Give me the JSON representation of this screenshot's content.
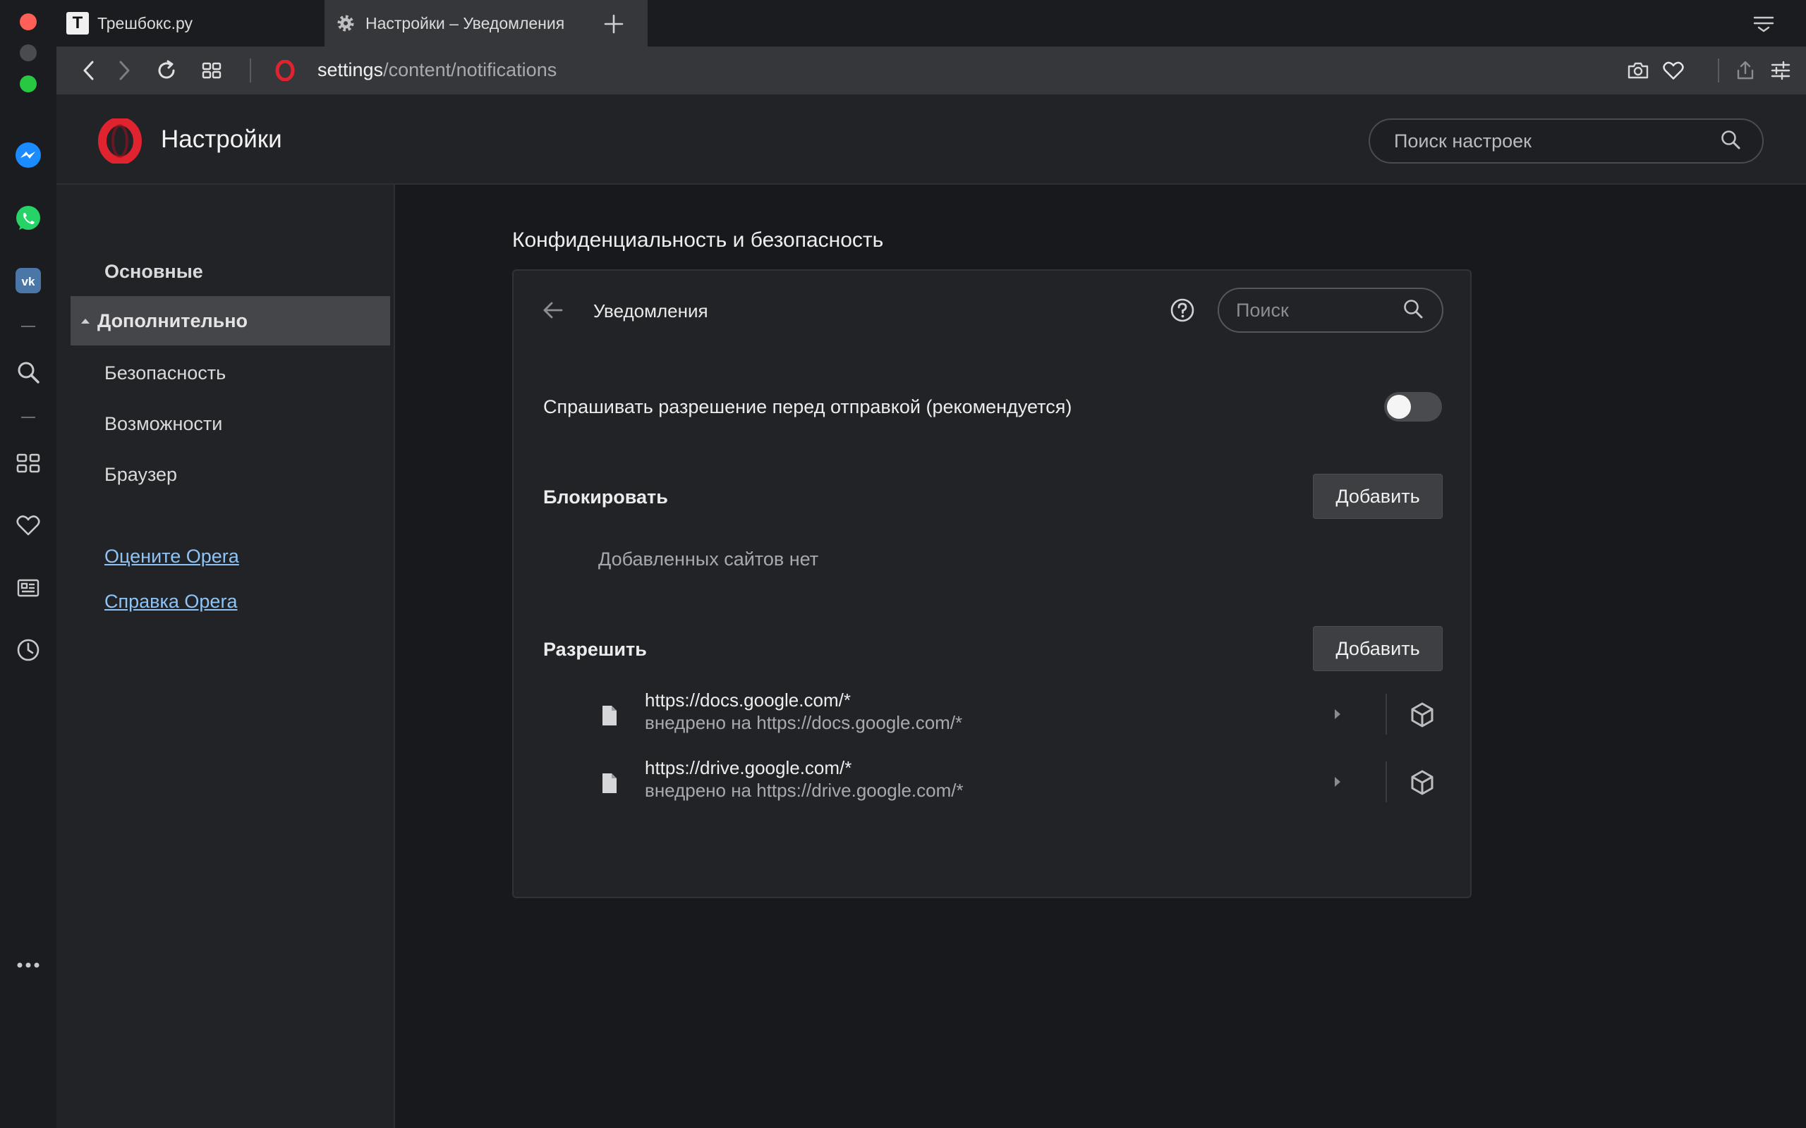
{
  "tabs": [
    {
      "title": "Трешбокс.ру",
      "favicon_letter": "T",
      "active": false
    },
    {
      "title": "Настройки – Уведомления",
      "active": true
    }
  ],
  "address": {
    "host": "settings",
    "path": "/content/notifications"
  },
  "header": {
    "title": "Настройки",
    "search_placeholder": "Поиск настроек"
  },
  "nav": {
    "basic": "Основные",
    "advanced": "Дополнительно",
    "security": "Безопасность",
    "features": "Возможности",
    "browser": "Браузер",
    "rate_link": "Оцените Opera",
    "help_link": "Справка Opera"
  },
  "main": {
    "section_title": "Конфиденциальность и безопасность",
    "card_title": "Уведомления",
    "search_placeholder": "Поиск",
    "ask_permission_label": "Спрашивать разрешение перед отправкой (рекомендуется)",
    "ask_permission_enabled": false,
    "block_label": "Блокировать",
    "block_add_label": "Добавить",
    "block_empty": "Добавленных сайтов нет",
    "allow_label": "Разрешить",
    "allow_add_label": "Добавить",
    "allow_sites": [
      {
        "url": "https://docs.google.com/*",
        "embedded": "внедрено на https://docs.google.com/*"
      },
      {
        "url": "https://drive.google.com/*",
        "embedded": "внедрено на https://drive.google.com/*"
      }
    ]
  },
  "colors": {
    "opera_red": "#e0232e",
    "link": "#8ec3f6",
    "close": "#fe5f57",
    "zoom": "#28c840"
  }
}
